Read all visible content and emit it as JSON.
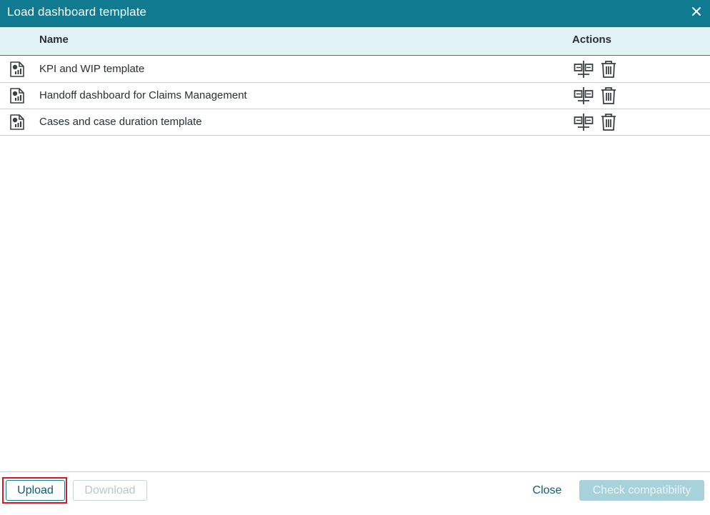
{
  "dialog": {
    "title": "Load dashboard template",
    "close_icon": "close-icon",
    "accent_color": "#107a91"
  },
  "table": {
    "columns": {
      "name": "Name",
      "actions": "Actions"
    },
    "rows": [
      {
        "icon": "dashboard-file-icon",
        "name": "KPI and WIP template"
      },
      {
        "icon": "dashboard-file-icon",
        "name": "Handoff dashboard for Claims Management"
      },
      {
        "icon": "dashboard-file-icon",
        "name": "Cases and case duration template"
      }
    ],
    "row_actions": [
      "compare-icon",
      "trash-icon"
    ]
  },
  "footer": {
    "upload_label": "Upload",
    "download_label": "Download",
    "close_label": "Close",
    "check_label": "Check compatibility"
  }
}
